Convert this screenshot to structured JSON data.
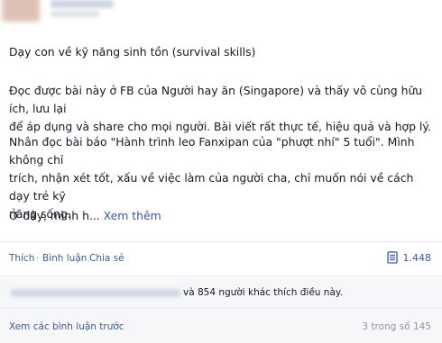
{
  "post": {
    "title": "Dạy con về kỹ năng sinh tồn (survival skills)",
    "paragraph1_line1": "Đọc được bài này ở FB của Người hay ăn (Singapore) và thấy vô cùng hữu ích, lưu lại",
    "paragraph1_line2": "để áp dụng và share cho mọi người. Bài viết rất thực tế, hiệu quả và hợp lý.",
    "paragraph2_line1": "Nhân đọc bài báo \"Hành trình leo Fanxipan của \"phượt nhí\" 5 tuổi\". Mình không chỉ",
    "paragraph2_line2": "trích, nhận xét tốt, xấu về việc làm của người cha, chỉ muốn nói về cách dạy trẻ kỹ",
    "paragraph2_line3": "năng sống.",
    "paragraph3_prefix": "Ở đây, mình h...",
    "see_more": "Xem thêm"
  },
  "actions": {
    "like": "Thích",
    "comment": "Bình luận",
    "share": "Chia sẻ",
    "separator": "·",
    "share_count": "1.448"
  },
  "likes": {
    "text": "và 854 người khác thích điều này."
  },
  "comments": {
    "view_previous": "Xem các bình luận trước",
    "count": "3 trong số 145"
  },
  "colors": {
    "link": "#3b5998",
    "muted": "#90949c",
    "text": "#141823",
    "panel_bg": "#f6f7f9"
  }
}
